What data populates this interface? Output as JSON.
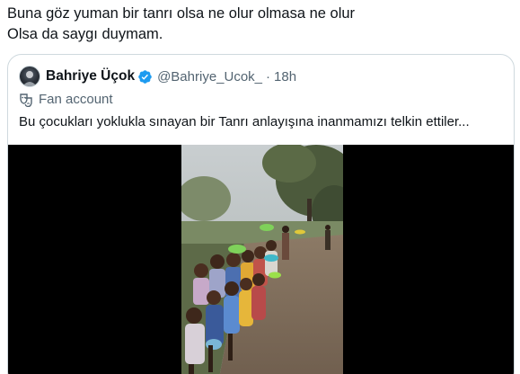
{
  "tweet": {
    "line1": "Buna göz yuman bir tanrı olsa ne olur olmasa ne olur",
    "line2": "Olsa da saygı duymam."
  },
  "quote": {
    "display_name": "Bahriye Üçok",
    "handle": "@Bahriye_Ucok_",
    "separator": "·",
    "time": "18h",
    "label": "Fan account",
    "text": "Bu çocukları yoklukla sınayan bir Tanrı anlayışına inanmamızı telkin ettiler..."
  },
  "colors": {
    "verified": "#1d9bf0",
    "secondary_text": "#536471",
    "border": "#cfd9de"
  },
  "icons": {
    "verified": "verified-badge-icon",
    "fan_account": "theater-mask-icon"
  }
}
